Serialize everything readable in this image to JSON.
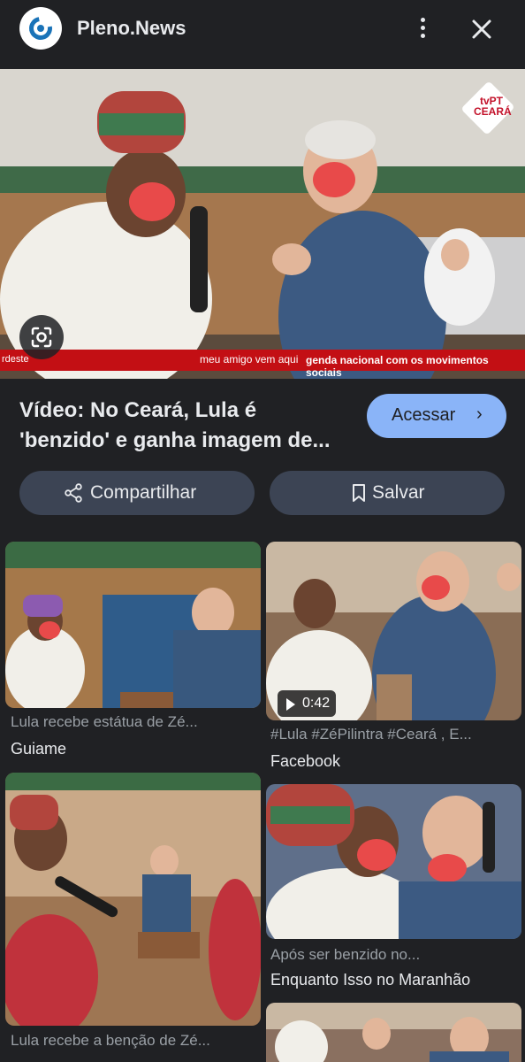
{
  "header": {
    "site_name": "Pleno.News",
    "logo_icon": "pleno-news-logo",
    "menu_icon": "more-vert-icon",
    "close_icon": "close-icon"
  },
  "hero": {
    "channel_logo_text": "tvPT CEARÁ",
    "caption_left": "rdeste",
    "caption_main": "meu amigo vem aqui",
    "caption_right": "genda nacional com os movimentos sociais",
    "lens_icon": "google-lens-icon"
  },
  "result": {
    "title": "Vídeo: No Ceará, Lula é 'benzido' e ganha imagem de...",
    "title_line1": "Vídeo: No Ceará, Lula é",
    "title_line2": "'benzido' e ganha imagem de...",
    "visit_label": "Acessar",
    "visit_icon": "chevron-right-icon"
  },
  "actions": {
    "share_label": "Compartilhar",
    "share_icon": "share-icon",
    "save_label": "Salvar",
    "save_icon": "bookmark-icon"
  },
  "related": [
    {
      "title": "Lula recebe estátua de Zé...",
      "source": "Guiame"
    },
    {
      "title": "#Lula #ZéPilintra #Ceará , E...",
      "source": "Facebook",
      "duration": "0:42"
    },
    {
      "title": "Lula recebe a benção de Zé...",
      "source": ""
    },
    {
      "title": "Após ser benzido no...",
      "source": "Enquanto Isso no Maranhão"
    }
  ],
  "colors": {
    "background": "#202124",
    "accent_button": "#8ab4f8",
    "pill_button": "#3c4454",
    "caption_red": "#c30f14"
  }
}
